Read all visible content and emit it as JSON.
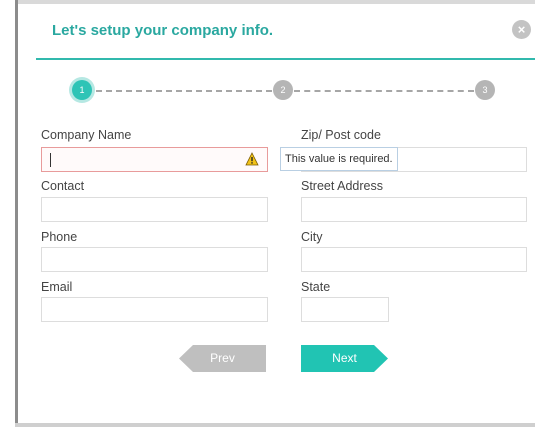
{
  "dialog": {
    "title": "Let's setup your company info.",
    "close_symbol": "×",
    "accent_color": "#2ec4b6"
  },
  "stepper": {
    "steps": [
      {
        "label": "1",
        "state": "active"
      },
      {
        "label": "2",
        "state": "inactive"
      },
      {
        "label": "3",
        "state": "inactive"
      }
    ]
  },
  "form": {
    "left": [
      {
        "label": "Company Name",
        "value": "",
        "error": true
      },
      {
        "label": "Contact",
        "value": ""
      },
      {
        "label": "Phone",
        "value": ""
      },
      {
        "label": "Email",
        "value": ""
      }
    ],
    "right": [
      {
        "label": "Zip/ Post code",
        "value": ""
      },
      {
        "label": "Street Address",
        "value": ""
      },
      {
        "label": "City",
        "value": ""
      },
      {
        "label": "State",
        "value": ""
      }
    ],
    "validation_message": "This value is required."
  },
  "buttons": {
    "prev": "Prev",
    "next": "Next"
  },
  "icons": {
    "close": "close-icon",
    "warning": "warning-icon"
  }
}
